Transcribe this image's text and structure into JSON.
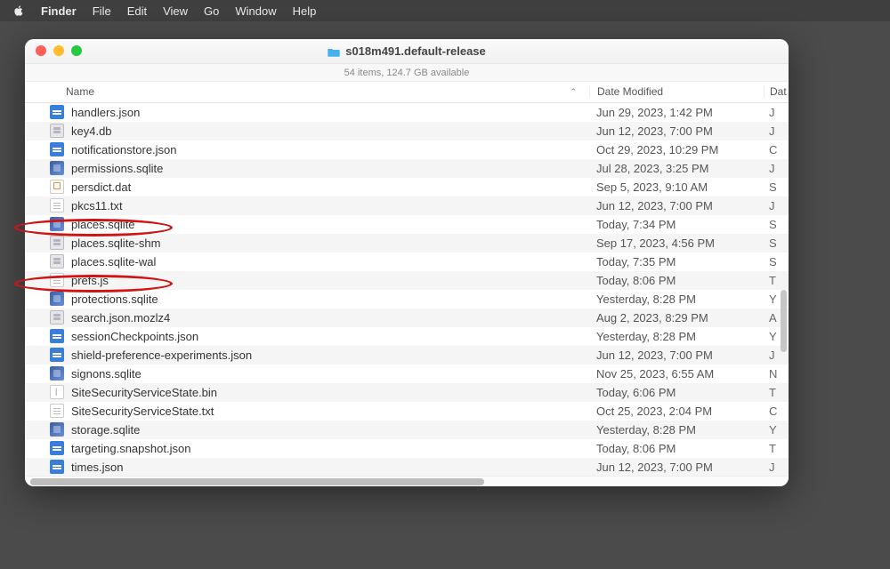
{
  "menubar": {
    "app": "Finder",
    "items": [
      "File",
      "Edit",
      "View",
      "Go",
      "Window",
      "Help"
    ]
  },
  "window": {
    "title": "s018m491.default-release",
    "status": "54 items, 124.7 GB available"
  },
  "columns": {
    "name": "Name",
    "date": "Date Modified",
    "extra": "Dat"
  },
  "files": [
    {
      "icon": "json",
      "name": "handlers.json",
      "date": "Jun 29, 2023, 1:42 PM",
      "ext": "J"
    },
    {
      "icon": "db",
      "name": "key4.db",
      "date": "Jun 12, 2023, 7:00 PM",
      "ext": "J"
    },
    {
      "icon": "json",
      "name": "notificationstore.json",
      "date": "Oct 29, 2023, 10:29 PM",
      "ext": "C"
    },
    {
      "icon": "sqlite",
      "name": "permissions.sqlite",
      "date": "Jul 28, 2023, 3:25 PM",
      "ext": "J"
    },
    {
      "icon": "dat",
      "name": "persdict.dat",
      "date": "Sep 5, 2023, 9:10 AM",
      "ext": "S"
    },
    {
      "icon": "txt",
      "name": "pkcs11.txt",
      "date": "Jun 12, 2023, 7:00 PM",
      "ext": "J"
    },
    {
      "icon": "sqlite",
      "name": "places.sqlite",
      "date": "Today, 7:34 PM",
      "ext": "S"
    },
    {
      "icon": "db",
      "name": "places.sqlite-shm",
      "date": "Sep 17, 2023, 4:56 PM",
      "ext": "S"
    },
    {
      "icon": "db",
      "name": "places.sqlite-wal",
      "date": "Today, 7:35 PM",
      "ext": "S"
    },
    {
      "icon": "txt",
      "name": "prefs.js",
      "date": "Today, 8:06 PM",
      "ext": "T"
    },
    {
      "icon": "sqlite",
      "name": "protections.sqlite",
      "date": "Yesterday, 8:28 PM",
      "ext": "Y"
    },
    {
      "icon": "db",
      "name": "search.json.mozlz4",
      "date": "Aug 2, 2023, 8:29 PM",
      "ext": "A"
    },
    {
      "icon": "json",
      "name": "sessionCheckpoints.json",
      "date": "Yesterday, 8:28 PM",
      "ext": "Y"
    },
    {
      "icon": "json",
      "name": "shield-preference-experiments.json",
      "date": "Jun 12, 2023, 7:00 PM",
      "ext": "J"
    },
    {
      "icon": "sqlite",
      "name": "signons.sqlite",
      "date": "Nov 25, 2023, 6:55 AM",
      "ext": "N"
    },
    {
      "icon": "bin",
      "name": "SiteSecurityServiceState.bin",
      "date": "Today, 6:06 PM",
      "ext": "T"
    },
    {
      "icon": "txt",
      "name": "SiteSecurityServiceState.txt",
      "date": "Oct 25, 2023, 2:04 PM",
      "ext": "C"
    },
    {
      "icon": "sqlite",
      "name": "storage.sqlite",
      "date": "Yesterday, 8:28 PM",
      "ext": "Y"
    },
    {
      "icon": "json",
      "name": "targeting.snapshot.json",
      "date": "Today, 8:06 PM",
      "ext": "T"
    },
    {
      "icon": "json",
      "name": "times.json",
      "date": "Jun 12, 2023, 7:00 PM",
      "ext": "J"
    }
  ],
  "annotations": [
    {
      "target": "places.sqlite"
    },
    {
      "target": "prefs.js"
    }
  ]
}
